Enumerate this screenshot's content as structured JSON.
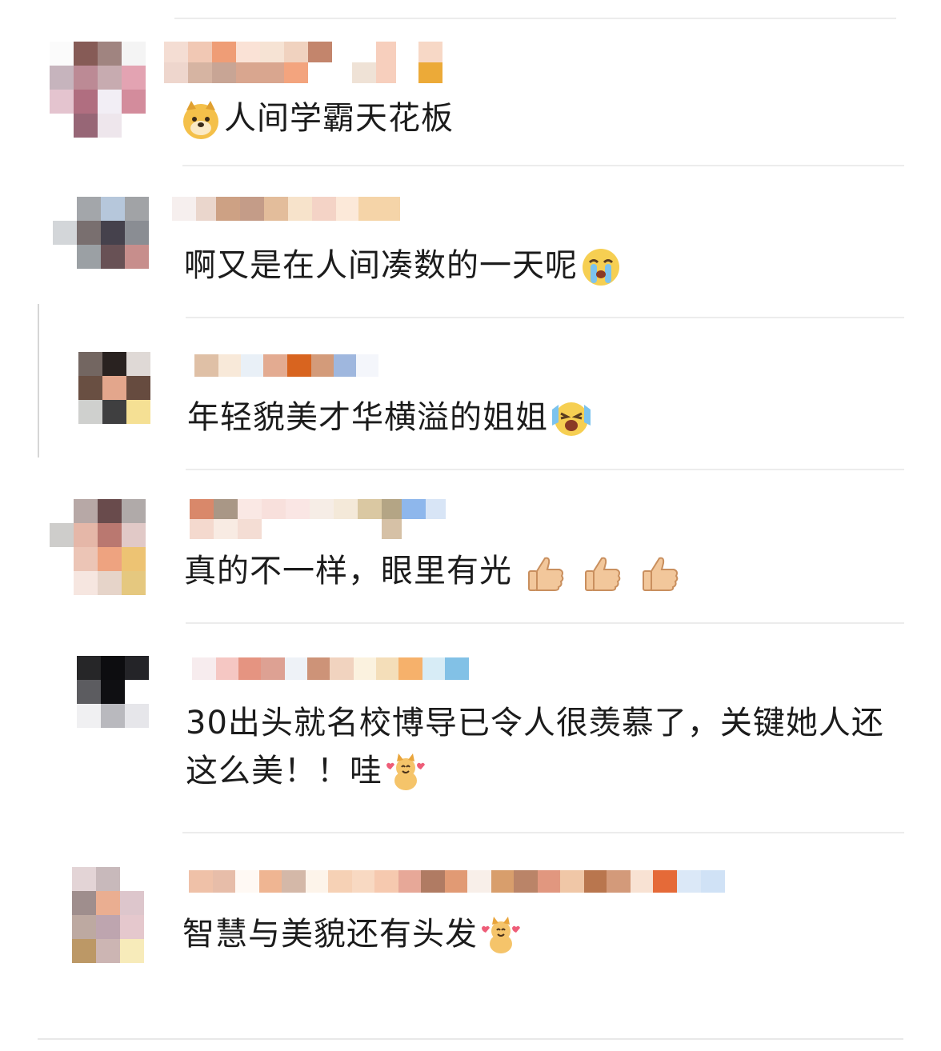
{
  "comments": [
    {
      "text_before": "",
      "text": "人间学霸天花板",
      "emoji_position": "before",
      "emoji": "doge-face-icon"
    },
    {
      "text": "啊又是在人间凑数的一天呢",
      "emoji_position": "after",
      "emoji": "crying-face-icon"
    },
    {
      "text": "年轻貌美才华横溢的姐姐",
      "emoji_position": "after",
      "emoji": "tears-of-joy-face-icon"
    },
    {
      "text": "真的不一样，眼里有光",
      "emoji_position": "after",
      "emoji": "thumbs-up-icon"
    },
    {
      "text": "30出头就名校博导已令人很羡慕了，关键她人还这么美！！哇",
      "emoji_position": "after",
      "emoji": "cheering-cat-icon"
    },
    {
      "text": "智慧与美貌还有头发",
      "emoji_position": "after",
      "emoji": "cheering-cat-icon"
    }
  ],
  "colors": {
    "divider": "#ececec",
    "text": "#1c1c1c",
    "background": "#ffffff"
  }
}
